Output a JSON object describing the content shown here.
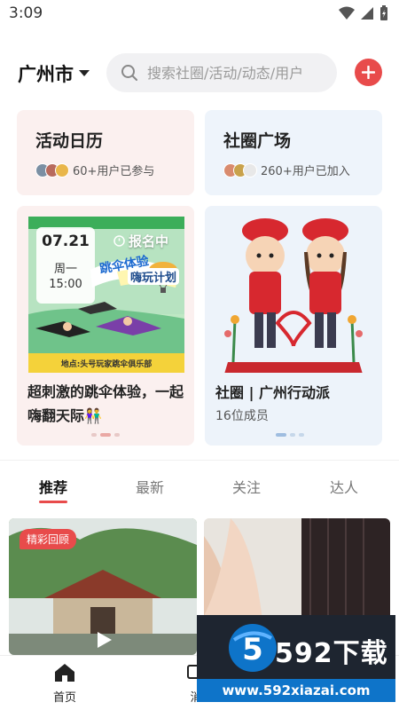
{
  "status_bar": {
    "time": "3:09"
  },
  "header": {
    "city": "广州市",
    "search_placeholder": "搜索社圈/活动/动态/用户"
  },
  "cards": {
    "activity": {
      "title": "活动日历",
      "meta": "60+用户已参与"
    },
    "circle": {
      "title": "社圈广场",
      "meta": "260+用户已加入"
    }
  },
  "featured": {
    "event": {
      "date": "07.21",
      "weekday": "周一",
      "time": "15:00",
      "status": "报名中",
      "poster_banner": "地点:头号玩家跳伞俱乐部",
      "poster_headline": "跳伞体验",
      "poster_sub": "嗨玩计划",
      "title": "超刺激的跳伞体验，一起嗨翻天际👫"
    },
    "group": {
      "title": "社圈 | 广州行动派",
      "members": "16位成员"
    }
  },
  "tabs": [
    "推荐",
    "最新",
    "关注",
    "达人"
  ],
  "feed": {
    "badge": "精彩回顾"
  },
  "bottom_nav": {
    "home": "首页",
    "messages_partial": "消"
  },
  "watermark": {
    "brand": "592下载",
    "url": "www.592xiazai.com"
  },
  "colors": {
    "accent": "#e84b4b",
    "brand_blue": "#0e74c9"
  }
}
